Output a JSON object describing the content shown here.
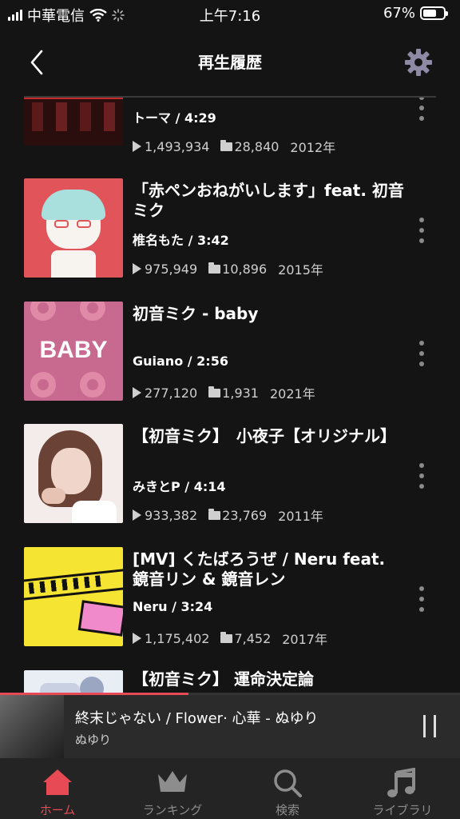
{
  "status": {
    "carrier": "中華電信",
    "time": "上午7:16",
    "battery_pct": "67%",
    "battery_level": 0.67
  },
  "header": {
    "title": "再生履歴"
  },
  "items": [
    {
      "title": "",
      "meta": "トーマ / 4:29",
      "plays": "1,493,934",
      "saves": "28,840",
      "year": "2012年",
      "colors": [
        "#2a0d0d",
        "#c42c2c",
        "#f2e6dd"
      ]
    },
    {
      "title": "「赤ペンおねがいします」feat. 初音ミク",
      "meta": "椎名もた / 3:42",
      "plays": "975,949",
      "saves": "10,896",
      "year": "2015年",
      "colors": [
        "#e0545a",
        "#f7f4ef",
        "#a9e0de"
      ]
    },
    {
      "title": "初音ミク - baby",
      "meta": "Guiano / 2:56",
      "plays": "277,120",
      "saves": "1,931",
      "year": "2021年",
      "cover_text": "BABY",
      "colors": [
        "#c86a8f",
        "#e08aa8",
        "#ffffff"
      ]
    },
    {
      "title": "【初音ミク】　小夜子【オリジナル】",
      "meta": "みきとP / 4:14",
      "plays": "933,382",
      "saves": "23,769",
      "year": "2011年",
      "colors": [
        "#f4ecea",
        "#b08070",
        "#4b2f28"
      ]
    },
    {
      "title": "[MV] くたばろうぜ / Neru feat. 鏡音リン & 鏡音レン",
      "meta": "Neru / 3:24",
      "plays": "1,175,402",
      "saves": "7,452",
      "year": "2017年",
      "colors": [
        "#f5e431",
        "#111111",
        "#f08acb"
      ]
    },
    {
      "title": "【初音ミク】 運命決定論",
      "meta": "",
      "plays": "",
      "saves": "",
      "year": "",
      "colors": [
        "#e9eef4",
        "#9aa6c2",
        "#3c4770"
      ]
    }
  ],
  "now_playing": {
    "title": "終末じゃない / Flower· 心華 - ぬゆり",
    "artist": "ぬゆり",
    "progress": 0.41
  },
  "tabs": [
    {
      "label": "ホーム",
      "icon": "home-icon",
      "active": true
    },
    {
      "label": "ランキング",
      "icon": "crown-icon",
      "active": false
    },
    {
      "label": "検索",
      "icon": "search-icon",
      "active": false
    },
    {
      "label": "ライブラリ",
      "icon": "music-note-icon",
      "active": false
    }
  ],
  "accent_color": "#e84a55"
}
